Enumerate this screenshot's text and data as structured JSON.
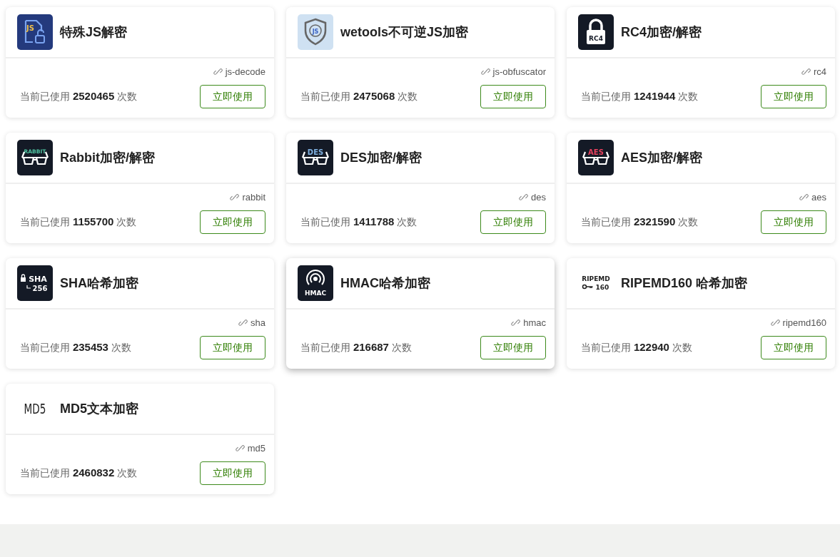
{
  "cards": [
    {
      "title": "特殊JS解密",
      "slug": "js-decode",
      "usage": "当前已使用 **2520465** 次数",
      "button": "立即使用",
      "hovered": false,
      "icon": {
        "kind": "js-file",
        "texts": [
          "JS"
        ]
      }
    },
    {
      "title": "wetools不可逆JS加密",
      "slug": "js-obfuscator",
      "usage": "当前已使用 **2475068** 次数",
      "button": "立即使用",
      "hovered": false,
      "icon": {
        "kind": "shield",
        "texts": [
          "JS"
        ]
      }
    },
    {
      "title": "RC4加密/解密",
      "slug": "rc4",
      "usage": "当前已使用 **1241944** 次数",
      "button": "立即使用",
      "hovered": false,
      "icon": {
        "kind": "lock",
        "texts": [
          "RC4"
        ]
      }
    },
    {
      "title": "Rabbit加密/解密",
      "slug": "rabbit",
      "usage": "当前已使用 **1155700** 次数",
      "button": "立即使用",
      "hovered": false,
      "icon": {
        "kind": "glasses",
        "texts": [
          "RABBIT"
        ],
        "color": "#4fc3a1"
      }
    },
    {
      "title": "DES加密/解密",
      "slug": "des",
      "usage": "当前已使用 **1411788** 次数",
      "button": "立即使用",
      "hovered": false,
      "icon": {
        "kind": "glasses",
        "texts": [
          "DES"
        ],
        "color": "#7fb0e0"
      }
    },
    {
      "title": "AES加密/解密",
      "slug": "aes",
      "usage": "当前已使用 **2321590** 次数",
      "button": "立即使用",
      "hovered": false,
      "icon": {
        "kind": "glasses",
        "texts": [
          "AES"
        ],
        "color": "#e8415e"
      }
    },
    {
      "title": "SHA哈希加密",
      "slug": "sha",
      "usage": "当前已使用 **235453** 次数",
      "button": "立即使用",
      "hovered": false,
      "icon": {
        "kind": "sha",
        "texts": [
          "SHA",
          "256"
        ]
      }
    },
    {
      "title": "HMAC哈希加密",
      "slug": "hmac",
      "usage": "当前已使用 **216687** 次数",
      "button": "立即使用",
      "hovered": true,
      "icon": {
        "kind": "hmac",
        "texts": [
          "HMAC"
        ]
      }
    },
    {
      "title": "RIPEMD160 哈希加密",
      "slug": "ripemd160",
      "usage": "当前已使用 **122940** 次数",
      "button": "立即使用",
      "hovered": false,
      "icon": {
        "kind": "ripemd",
        "texts": [
          "RIPEMD",
          "160"
        ]
      }
    },
    {
      "title": "MD5文本加密",
      "slug": "md5",
      "usage": "当前已使用 **2460832** 次数",
      "button": "立即使用",
      "hovered": false,
      "icon": {
        "kind": "md5",
        "texts": [
          "MD5"
        ]
      }
    }
  ]
}
